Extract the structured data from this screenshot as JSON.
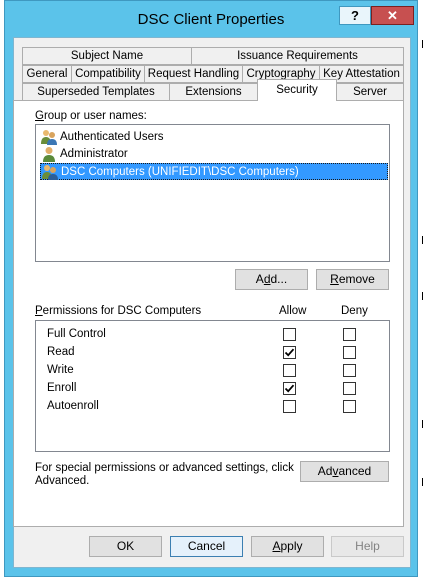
{
  "window": {
    "title": "DSC Client Properties",
    "help_label": "?",
    "close_label": "✕"
  },
  "tabs": {
    "row1": [
      "Subject Name",
      "Issuance Requirements"
    ],
    "row2": [
      "General",
      "Compatibility",
      "Request Handling",
      "Cryptography",
      "Key Attestation"
    ],
    "row3": [
      "Superseded Templates",
      "Extensions",
      "Security",
      "Server"
    ],
    "active": "Security"
  },
  "security": {
    "group_label_prefix": "G",
    "group_label_rest": "roup or user names:",
    "users": [
      {
        "name": "Authenticated Users",
        "icon": "users-group-icon",
        "selected": false
      },
      {
        "name": "Administrator",
        "icon": "user-icon",
        "selected": false
      },
      {
        "name": "DSC Computers (UNIFIEDIT\\DSC Computers)",
        "icon": "users-group-icon",
        "selected": true
      }
    ],
    "add_button": {
      "pre": "A",
      "accel": "d",
      "post": "d..."
    },
    "remove_button": {
      "pre": "",
      "accel": "R",
      "post": "emove"
    },
    "permissions_label_accel": "P",
    "permissions_label_rest": "ermissions for DSC Computers",
    "allow_header": "Allow",
    "deny_header": "Deny",
    "permissions": [
      {
        "name": "Full Control",
        "allow": false,
        "deny": false
      },
      {
        "name": "Read",
        "allow": true,
        "deny": false
      },
      {
        "name": "Write",
        "allow": false,
        "deny": false
      },
      {
        "name": "Enroll",
        "allow": true,
        "deny": false
      },
      {
        "name": "Autoenroll",
        "allow": false,
        "deny": false
      }
    ],
    "special_text_line1": "For special permissions or advanced settings, click",
    "special_text_line2": "Advanced.",
    "advanced_button": {
      "pre": "Ad",
      "accel": "v",
      "post": "anced"
    }
  },
  "footer": {
    "ok_label": "OK",
    "cancel_label": "Cancel",
    "apply_accel": "A",
    "apply_rest": "pply",
    "help_label": "Help"
  },
  "colors": {
    "title_bar": "#5bc3ea",
    "close_button": "#c75050",
    "selection": "#3399ff"
  }
}
